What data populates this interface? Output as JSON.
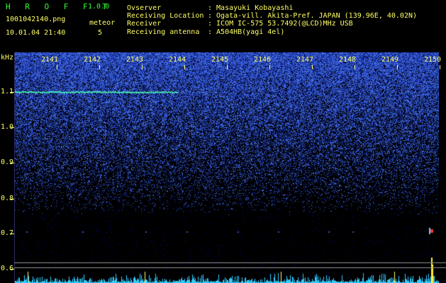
{
  "app": {
    "name": "H R O F F T",
    "version": "1.0.0",
    "filename": "1001042140.png",
    "timestamp": "10.01.04 21:40",
    "meteor_label": "meteor",
    "meteor_count": "5"
  },
  "info": {
    "labels": [
      "Ovserver",
      "Receiving Location",
      "Receiver",
      "Receiving antenna"
    ],
    "values": [
      ": Masayuki Kobayashi",
      ": Ogata-vill. Akita-Pref. JAPAN (139.96E, 40.02N)",
      ": ICOM IC-575 53.7492(@LCD)MHz USB",
      ": A504HB(yagi 4el)"
    ]
  },
  "axis": {
    "unit": "kHz",
    "y_labels": [
      "1.1",
      "1.0",
      "0.9",
      "0.8",
      "0.7",
      "0.6"
    ],
    "x_labels": [
      "2141",
      "2142",
      "2143",
      "2144",
      "2145",
      "2146",
      "2147",
      "2148",
      "2149",
      "2150"
    ]
  },
  "colors": {
    "background": "#000000",
    "text_yellow": "#ffff66",
    "title_green": "#33ff33",
    "noise_blue": "#2233cc",
    "signal_cyan": "#33ffcc"
  }
}
